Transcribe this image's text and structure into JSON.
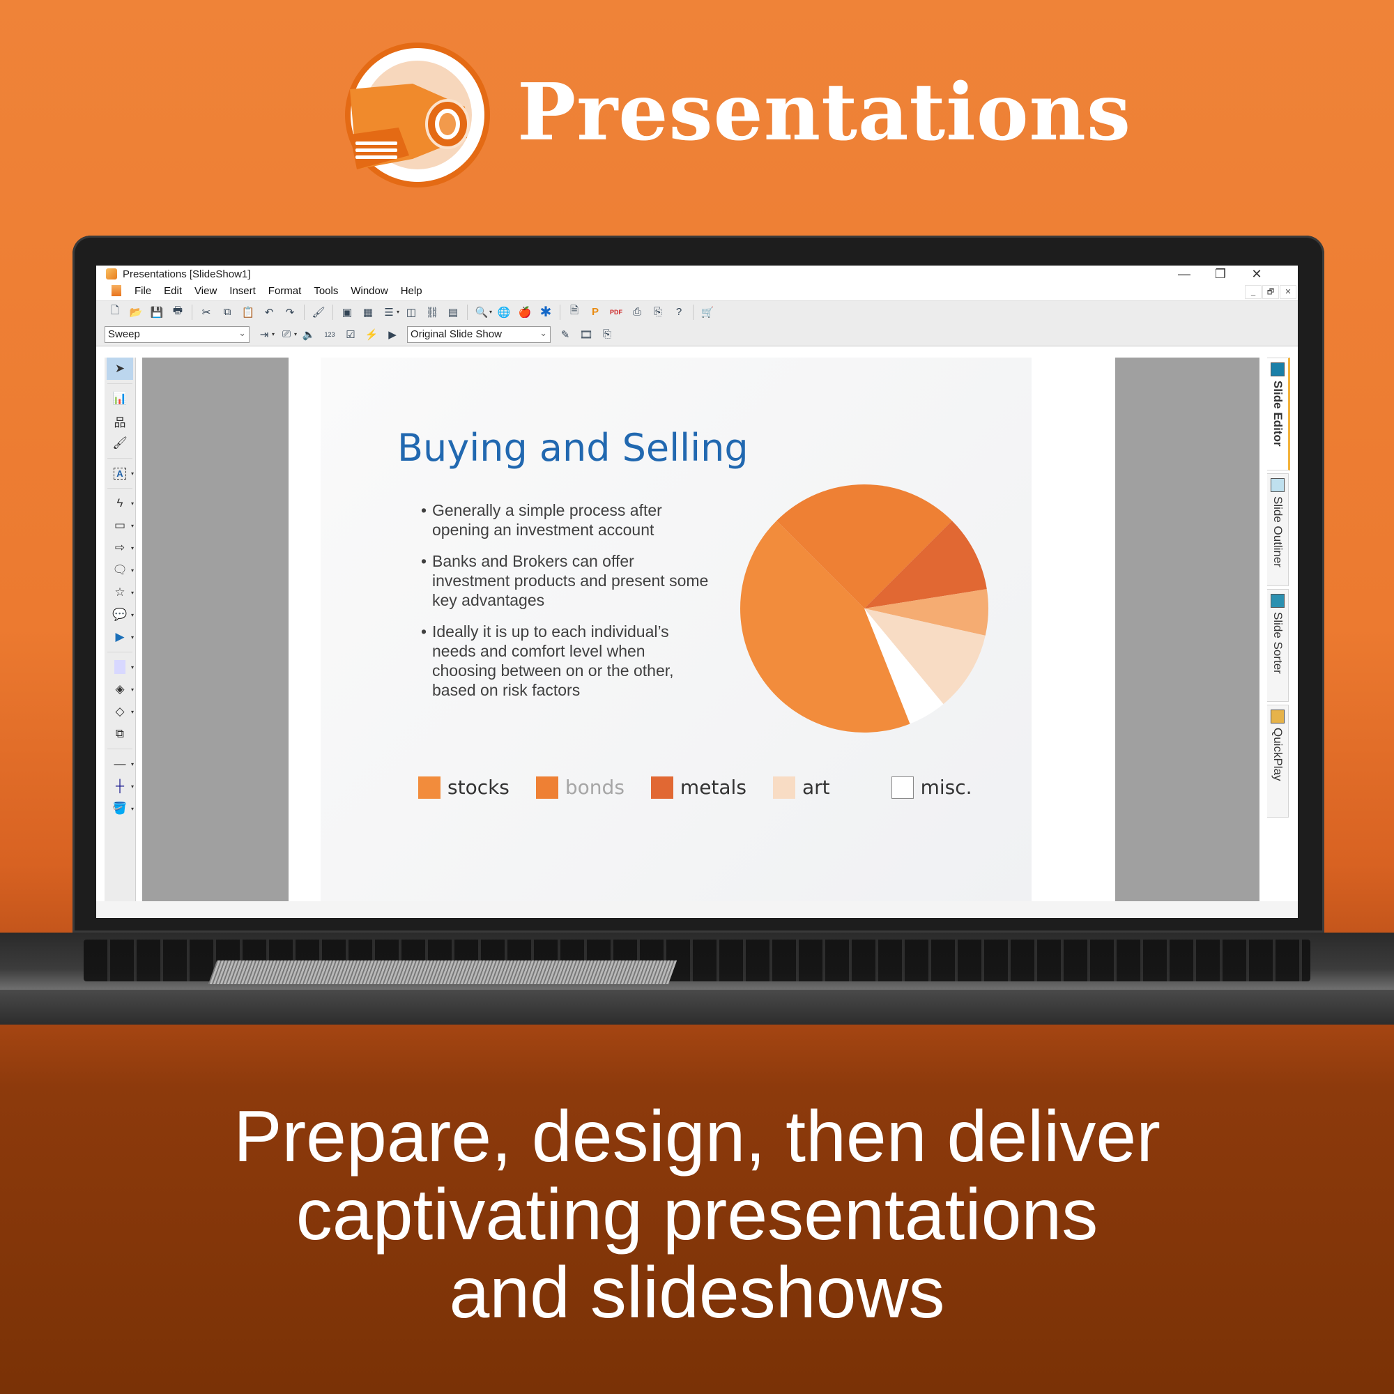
{
  "brand": {
    "name": "Presentations",
    "logo_icon": "projector-icon"
  },
  "tagline": [
    "Prepare, design, then deliver",
    "captivating presentations",
    "and slideshows"
  ],
  "app": {
    "window_title": "Presentations  [SlideShow1]",
    "window_controls": {
      "minimize": "—",
      "restore": "❐",
      "close": "✕"
    },
    "mdi_controls": {
      "minimize": "_",
      "restore": "🗗",
      "close": "✕"
    },
    "menu": [
      "File",
      "Edit",
      "View",
      "Insert",
      "Format",
      "Tools",
      "Window",
      "Help"
    ],
    "toolbar1": [
      {
        "name": "new-icon",
        "glyph": "🗋"
      },
      {
        "name": "open-icon",
        "glyph": "📂"
      },
      {
        "name": "save-icon",
        "glyph": "💾"
      },
      {
        "name": "print-icon",
        "glyph": "🖶"
      },
      {
        "name": "cut-icon",
        "glyph": "✂"
      },
      {
        "name": "copy-icon",
        "glyph": "⧉"
      },
      {
        "name": "paste-icon",
        "glyph": "📋"
      },
      {
        "name": "undo-icon",
        "glyph": "↶"
      },
      {
        "name": "redo-icon",
        "glyph": "↷"
      },
      {
        "name": "edit-image-icon",
        "glyph": "🖌"
      },
      {
        "name": "new-slide-icon",
        "glyph": "▣"
      },
      {
        "name": "layout-icon",
        "glyph": "▦"
      },
      {
        "name": "outline-icon",
        "glyph": "☰"
      },
      {
        "name": "object-icon",
        "glyph": "◫"
      },
      {
        "name": "link-icon",
        "glyph": "⛓"
      },
      {
        "name": "calendar-icon",
        "glyph": "▤"
      },
      {
        "name": "zoom-icon",
        "glyph": "🔍"
      },
      {
        "name": "globe-icon",
        "glyph": "🌐"
      },
      {
        "name": "apple-icon",
        "glyph": "🍎"
      },
      {
        "name": "asterisk-icon",
        "glyph": "✱"
      },
      {
        "name": "new-doc-icon",
        "glyph": "🗎"
      },
      {
        "name": "publish-icon",
        "glyph": "P"
      },
      {
        "name": "pdf-icon",
        "glyph": "PDF"
      },
      {
        "name": "export-icon",
        "glyph": "⎙"
      },
      {
        "name": "html-icon",
        "glyph": "⎘"
      },
      {
        "name": "help-icon",
        "glyph": "?"
      },
      {
        "name": "cart-icon",
        "glyph": "🛒"
      }
    ],
    "toolbar2": {
      "transition_select": "Sweep",
      "slideshow_select": "Original Slide Show",
      "icons": [
        {
          "name": "transition-icon",
          "glyph": "⇥"
        },
        {
          "name": "display-icon",
          "glyph": "⎚"
        },
        {
          "name": "sound-icon",
          "glyph": "🔈"
        },
        {
          "name": "numbering-icon",
          "glyph": "123"
        },
        {
          "name": "checklist-icon",
          "glyph": "☑"
        },
        {
          "name": "quick-icon",
          "glyph": "⚡"
        },
        {
          "name": "play-show-icon",
          "glyph": "▶"
        },
        {
          "name": "edit-show-icon",
          "glyph": "✎"
        },
        {
          "name": "film-icon",
          "glyph": "🎞"
        },
        {
          "name": "web-publish-icon",
          "glyph": "⎘"
        }
      ]
    },
    "left_tools": [
      {
        "name": "select-tool-icon",
        "glyph": "➤",
        "dd": false,
        "active": true
      },
      {
        "name": "sep"
      },
      {
        "name": "chart-tool-icon",
        "glyph": "📊",
        "dd": false
      },
      {
        "name": "orgchart-tool-icon",
        "glyph": "品",
        "dd": false
      },
      {
        "name": "brush-tool-icon",
        "glyph": "🖌",
        "dd": false
      },
      {
        "name": "sep"
      },
      {
        "name": "textbox-tool-icon",
        "glyph": "A",
        "dd": true
      },
      {
        "name": "sep"
      },
      {
        "name": "line-tool-icon",
        "glyph": "ϟ",
        "dd": true
      },
      {
        "name": "rectangle-tool-icon",
        "glyph": "▭",
        "dd": true
      },
      {
        "name": "arrow-tool-icon",
        "glyph": "⇨",
        "dd": true
      },
      {
        "name": "callout-tool-icon",
        "glyph": "🗨",
        "dd": true
      },
      {
        "name": "star-tool-icon",
        "glyph": "☆",
        "dd": true
      },
      {
        "name": "speech-tool-icon",
        "glyph": "💬",
        "dd": true
      },
      {
        "name": "action-tool-icon",
        "glyph": "▶",
        "dd": true
      },
      {
        "name": "sep"
      },
      {
        "name": "fill-tool-icon",
        "glyph": "▢",
        "dd": true
      },
      {
        "name": "shape-fill-tool-icon",
        "glyph": "◈",
        "dd": true
      },
      {
        "name": "shape-outline-tool-icon",
        "glyph": "◇",
        "dd": true
      },
      {
        "name": "arrange-tool-icon",
        "glyph": "⧉",
        "dd": false
      },
      {
        "name": "sep"
      },
      {
        "name": "line-style-tool-icon",
        "glyph": "—",
        "dd": true
      },
      {
        "name": "line-width-tool-icon",
        "glyph": "┼",
        "dd": true
      },
      {
        "name": "fill-color-tool-icon",
        "glyph": "🪣",
        "dd": true
      }
    ],
    "right_tabs": [
      {
        "label": "Slide Editor",
        "icon": "slide-editor-icon",
        "active": true
      },
      {
        "label": "Slide Outliner",
        "icon": "slide-outliner-icon",
        "active": false
      },
      {
        "label": "Slide Sorter",
        "icon": "slide-sorter-icon",
        "active": false
      },
      {
        "label": "QuickPlay",
        "icon": "quickplay-icon",
        "active": false
      }
    ]
  },
  "slide": {
    "title": "Buying and Selling",
    "bullets": [
      "Generally a simple process after opening an investment account",
      "Banks and Brokers can offer investment products and present some key advantages",
      "Ideally it is up to each individual’s needs and comfort level when choosing between on or the other, based on risk factors"
    ]
  },
  "chart_data": {
    "type": "pie",
    "title": "",
    "start": "top",
    "direction": "clockwise",
    "slices": [
      {
        "label": "bonds",
        "value": 25,
        "color": "#ee8034"
      },
      {
        "label": "metals",
        "value": 10,
        "color": "#e16833"
      },
      {
        "label": "",
        "value": 6,
        "color": "#f5ac72"
      },
      {
        "label": "art",
        "value": 10.5,
        "color": "#f8dcc4"
      },
      {
        "label": "misc.",
        "value": 5,
        "color": "#ffffff"
      },
      {
        "label": "stocks",
        "value": 43.5,
        "color": "#f28c3c"
      }
    ],
    "start_angle_deg": -45,
    "legend": [
      {
        "label": "stocks",
        "color": "#f28c3c",
        "text_color": "#333333"
      },
      {
        "label": "bonds",
        "color": "#ee8034",
        "text_color": "#a6a6a6"
      },
      {
        "label": "metals",
        "color": "#e16833",
        "text_color": "#333333"
      },
      {
        "label": "art",
        "color": "#f8dcc4",
        "text_color": "#333333"
      },
      {
        "label": "misc.",
        "color": "#ffffff",
        "text_color": "#333333"
      }
    ],
    "legend_position": "bottom"
  }
}
